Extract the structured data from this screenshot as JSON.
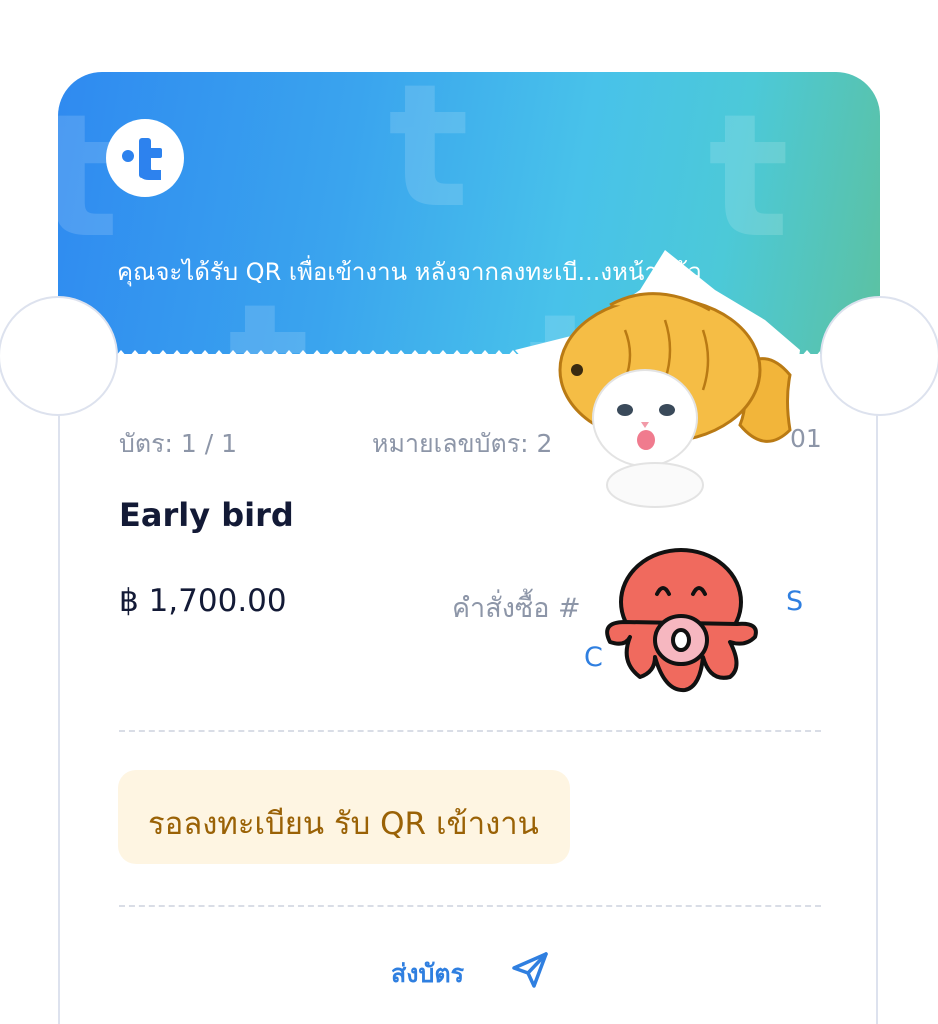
{
  "header": {
    "message": "คุณจะได้รับ QR เพื่อเข้างาน หลังจากลงทะเบี...งหน้าแล้ว",
    "logo_glyph": "t"
  },
  "ticket": {
    "card_label": "บัตร: 1 / 1",
    "ticket_number_label": "หมายเลขบัตร: 2",
    "ticket_number_tail": "01",
    "name": "Early bird",
    "price": "฿ 1,700.00",
    "order_label": "คำสั่งซื้อ #",
    "order_tail": "S",
    "order_second_line": "C"
  },
  "status": {
    "label": "รอลงทะเบียน รับ QR เข้างาน"
  },
  "actions": {
    "send_label": "ส่งบัตร"
  },
  "stickers": [
    "cat-taiyaki-sticker",
    "octopus-sticker"
  ],
  "colors": {
    "header_start": "#2f8af0",
    "header_end": "#5cc1a1",
    "accent": "#2f7fe0",
    "status_bg": "#fef5e2",
    "status_text": "#9a6206"
  }
}
